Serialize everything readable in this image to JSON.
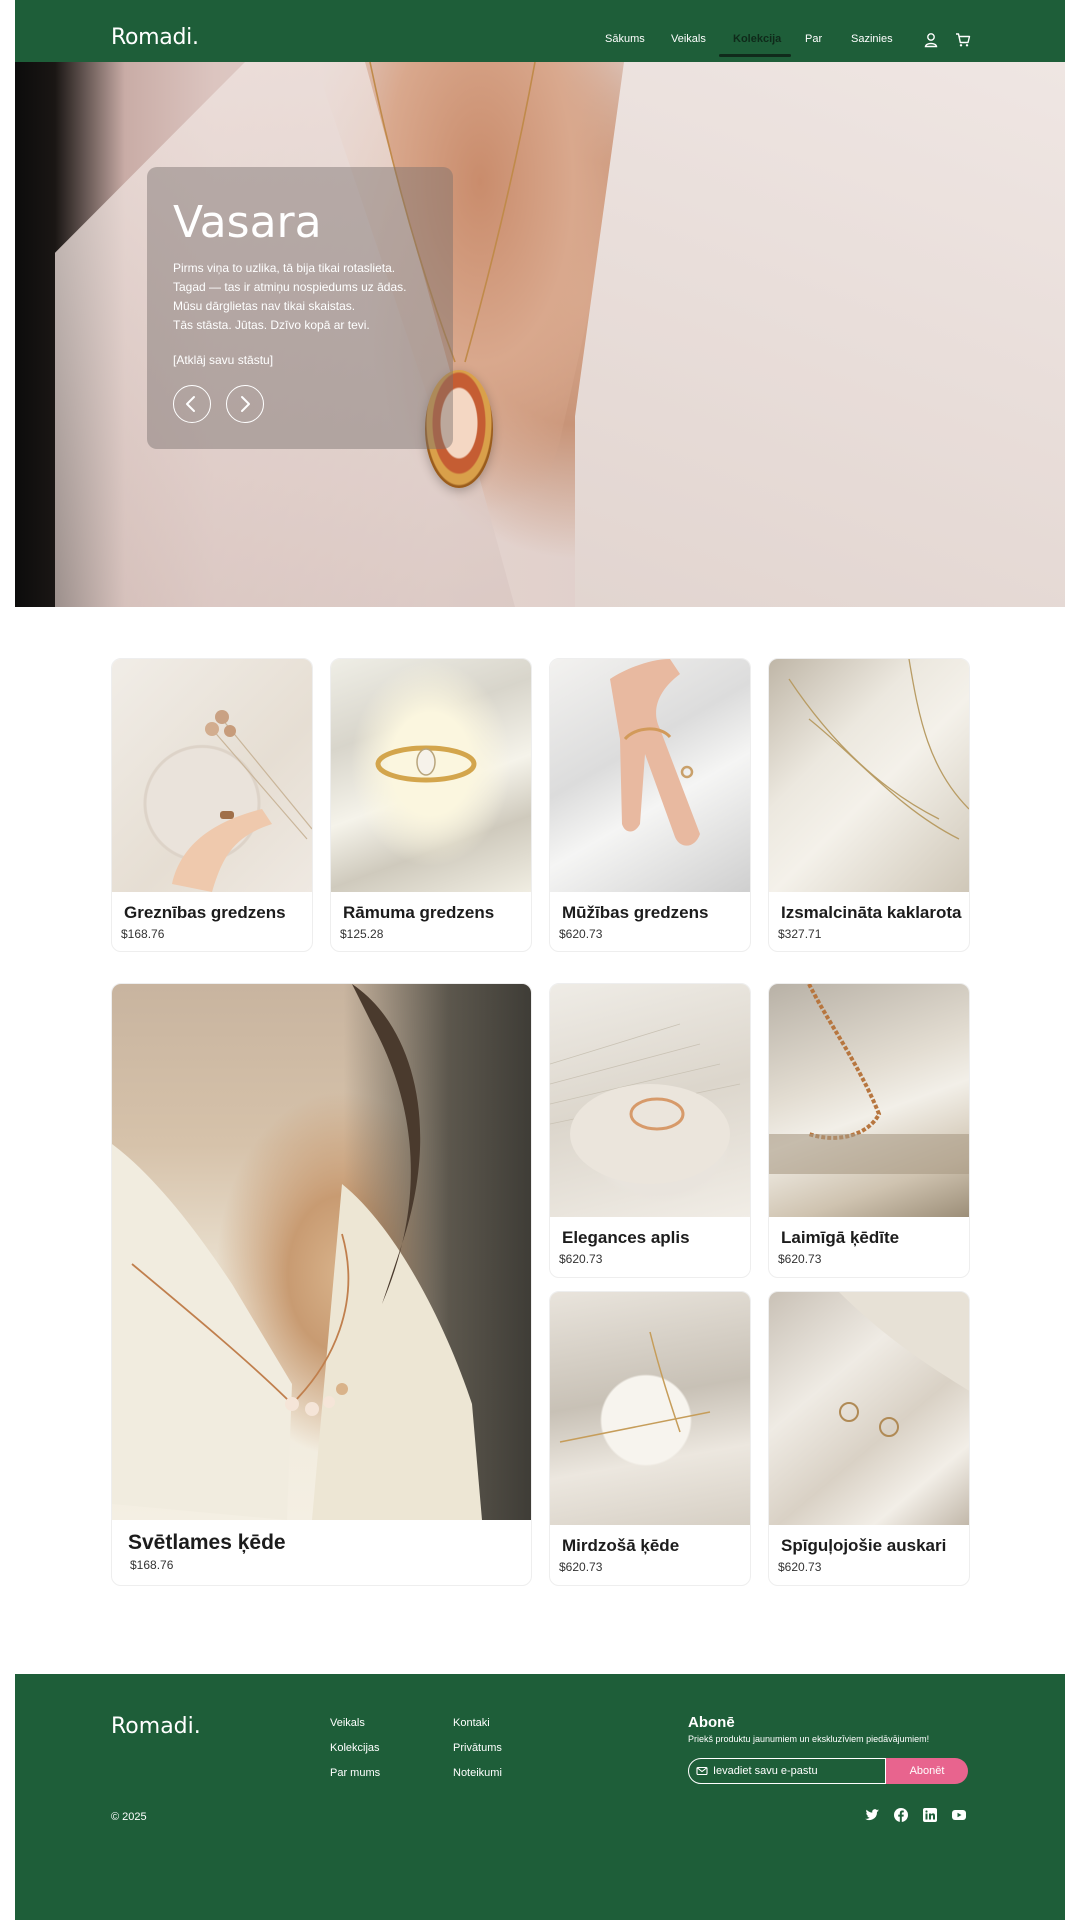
{
  "header": {
    "logo": "Romadi.",
    "nav": [
      {
        "label": "Sākums"
      },
      {
        "label": "Veikals"
      },
      {
        "label": "Kolekcija",
        "active": true
      },
      {
        "label": "Par"
      },
      {
        "label": "Sazinies"
      }
    ],
    "icons": [
      "user-icon",
      "cart-icon"
    ]
  },
  "hero": {
    "title": "Vasara",
    "lines": [
      "Pirms viņa to uzlika, tā bija tikai rotaslieta.",
      "Tagad — tas ir atmiņu nospiedums uz ādas.",
      "Mūsu dārglietas nav tikai skaistas.",
      "Tās stāsta. Jūtas. Dzīvo kopā ar tevi."
    ],
    "cta": "[Atklāj savu stāstu]",
    "controls": [
      "chevron-left-icon",
      "chevron-right-icon"
    ]
  },
  "products": [
    {
      "name": "Greznības gredzens",
      "price": "$168.76"
    },
    {
      "name": "Rāmuma gredzens",
      "price": "$125.28"
    },
    {
      "name": "Mūžības gredzens",
      "price": "$620.73"
    },
    {
      "name": "Izsmalcināta kaklarota",
      "price": "$327.71"
    },
    {
      "name": "Svētlames ķēde",
      "price": "$168.76"
    },
    {
      "name": "Elegances aplis",
      "price": "$620.73"
    },
    {
      "name": "Laimīgā ķēdīte",
      "price": "$620.73"
    },
    {
      "name": "Mirdzošā ķēde",
      "price": "$620.73"
    },
    {
      "name": "Spīguļojošie auskari",
      "price": "$620.73"
    }
  ],
  "footer": {
    "logo": "Romadi.",
    "col1": [
      "Veikals",
      "Kolekcijas",
      "Par mums"
    ],
    "col2": [
      "Kontaki",
      "Privātums",
      "Noteikumi"
    ],
    "subscribe": {
      "title": "Abonē",
      "desc": "Priekš produktu jaunumiem un ekskluzīviem piedāvājumiem!",
      "placeholder": "Ievadiet savu e-pastu",
      "button": "Abonēt"
    },
    "copyright": "© 2025",
    "social": [
      "twitter-icon",
      "facebook-icon",
      "linkedin-icon",
      "youtube-icon"
    ]
  },
  "colors": {
    "brand_green": "#1e5e39",
    "accent_pink": "#e8648e"
  }
}
